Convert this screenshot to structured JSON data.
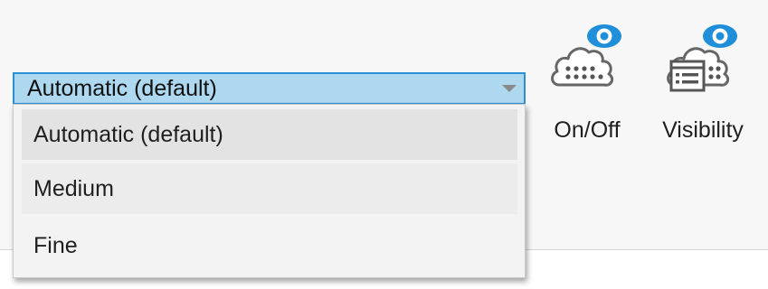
{
  "detail_combo": {
    "selected_value": "Automatic (default)",
    "options": [
      {
        "label": "Automatic (default)",
        "state": "selected"
      },
      {
        "label": "Medium",
        "state": "hover"
      },
      {
        "label": "Fine",
        "state": "normal"
      }
    ]
  },
  "ribbon_buttons": {
    "onoff": {
      "label": "On/Off",
      "icon": "cloud-eye-icon"
    },
    "visibility": {
      "label": "Visibility",
      "icon": "cloud-list-eye-icon"
    }
  },
  "colors": {
    "combo_fill": "#aed8f0",
    "combo_border": "#2b8fd4",
    "eye_badge": "#1e8fd8"
  }
}
